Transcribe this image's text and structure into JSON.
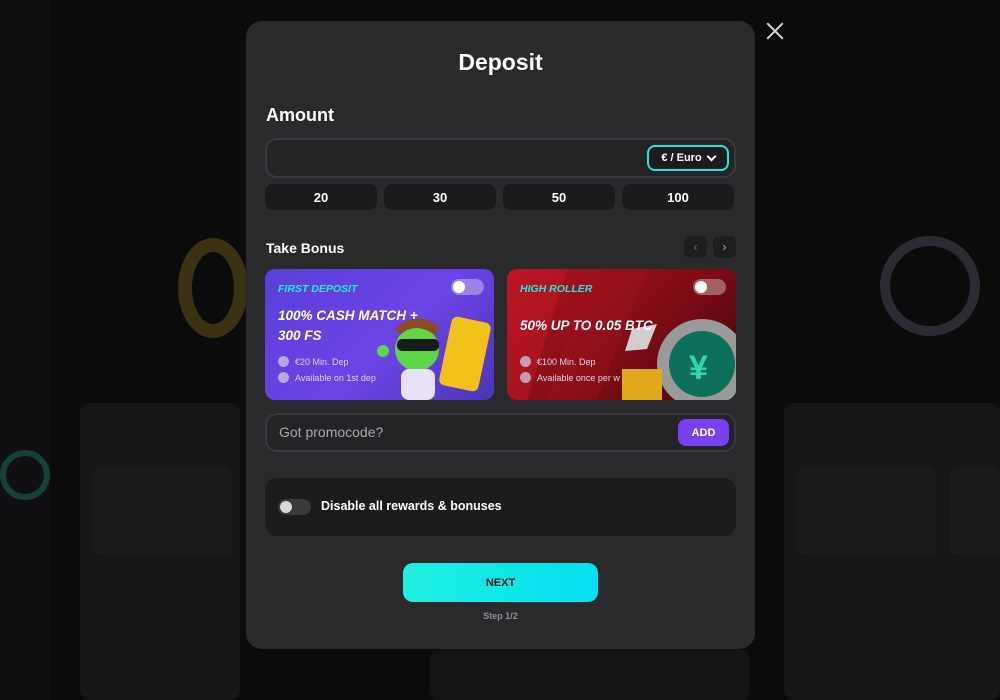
{
  "modal": {
    "title": "Deposit",
    "amount_label": "Amount",
    "amount_value": "",
    "currency": "€ / Euro",
    "presets": [
      "20",
      "30",
      "50",
      "100"
    ],
    "bonus_label": "Take Bonus",
    "bonuses": [
      {
        "tag": "FIRST DEPOSIT",
        "headline": "100% CASH MATCH + 300 FS",
        "min_dep": "€20 Min. Dep",
        "availability": "Available on 1st dep",
        "enabled": false
      },
      {
        "tag": "HIGH ROLLER",
        "headline": "50% UP TO 0.05 BTC",
        "min_dep": "€100 Min. Dep",
        "availability": "Available once per w",
        "enabled": false
      }
    ],
    "promo_placeholder": "Got promocode?",
    "promo_add_label": "ADD",
    "disable_label": "Disable all rewards & bonuses",
    "next_label": "NEXT",
    "step_text": "Step 1/2"
  },
  "colors": {
    "accent_cyan": "#1fe8d6",
    "accent_purple": "#7b3ff2",
    "modal_bg": "#2a2a2d"
  },
  "icons": {
    "close": "close-icon",
    "currency_dropdown": "chevron-down-icon",
    "prev": "chevron-left-icon",
    "next": "chevron-right-icon",
    "min_dep": "coin-icon",
    "availability": "clock-icon"
  }
}
